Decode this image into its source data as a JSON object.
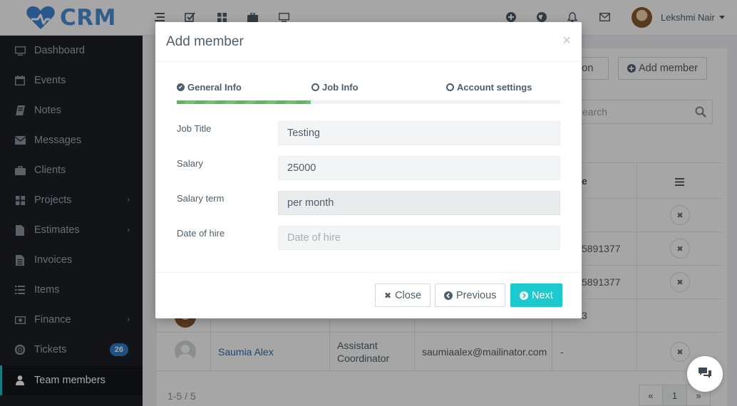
{
  "app": {
    "logo_text": "CRM"
  },
  "topbar": {
    "user_name": "Lekshmi Nair"
  },
  "sidebar": {
    "items": [
      {
        "label": "Dashboard",
        "icon": "monitor-icon"
      },
      {
        "label": "Events",
        "icon": "calendar-icon"
      },
      {
        "label": "Notes",
        "icon": "book-icon"
      },
      {
        "label": "Messages",
        "icon": "envelope-icon"
      },
      {
        "label": "Clients",
        "icon": "briefcase-icon"
      },
      {
        "label": "Projects",
        "icon": "grid-icon"
      },
      {
        "label": "Estimates",
        "icon": "file-icon"
      },
      {
        "label": "Invoices",
        "icon": "file-text-icon"
      },
      {
        "label": "Items",
        "icon": "list-icon"
      },
      {
        "label": "Finance",
        "icon": "money-icon"
      },
      {
        "label": "Tickets",
        "icon": "lifebuoy-icon",
        "badge": "26"
      },
      {
        "label": "Team members",
        "icon": "user-icon",
        "active": true
      }
    ]
  },
  "background": {
    "import_button_label": "tion",
    "add_member_button_label": "Add member",
    "search_placeholder": "earch",
    "column_phone_fragment": "e",
    "rows": [
      {
        "phone": "5891377"
      },
      {
        "phone": "5891377"
      },
      {
        "phone": "3"
      },
      {
        "name": "Saumia Alex",
        "job_title_line1": "Assistant",
        "job_title_line2": "Coordinator",
        "email": "saumiaalex@mailinator.com",
        "phone": "-"
      }
    ],
    "pagination_summary": "1-5 / 5",
    "pager": {
      "prev": "«",
      "current": "1",
      "next": "»"
    }
  },
  "modal": {
    "title": "Add member",
    "close_glyph": "×",
    "steps": [
      {
        "label": "General Info",
        "state": "done"
      },
      {
        "label": "Job Info",
        "state": "current"
      },
      {
        "label": "Account settings",
        "state": "pending"
      }
    ],
    "progress_percent": 35,
    "fields": {
      "job_title": {
        "label": "Job Title",
        "value": "Testing",
        "placeholder": "Job Title"
      },
      "salary": {
        "label": "Salary",
        "value": "25000",
        "placeholder": "Salary"
      },
      "salary_term": {
        "label": "Salary term",
        "value": "per month",
        "placeholder": "Salary term"
      },
      "date_of_hire": {
        "label": "Date of hire",
        "value": "",
        "placeholder": "Date of hire"
      }
    },
    "buttons": {
      "close": "Close",
      "previous": "Previous",
      "next": "Next"
    }
  },
  "colors": {
    "sidebar_bg": "#1c2026",
    "accent_teal": "#1ccacd",
    "progress_green": "#5cb85c",
    "badge_blue": "#2f7dc4",
    "logo_blue": "#4a8fd8"
  }
}
